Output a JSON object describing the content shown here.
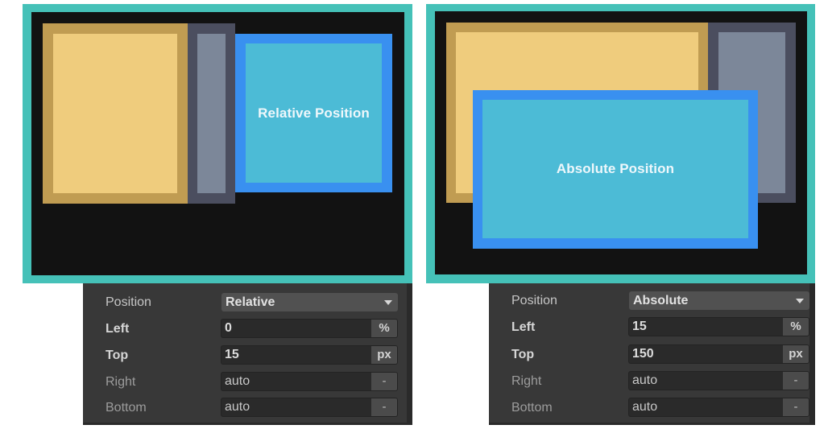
{
  "panels": [
    {
      "id": "relative",
      "box_label": "Relative Position",
      "inspector": {
        "position": {
          "label": "Position",
          "value": "Relative"
        },
        "left": {
          "label": "Left",
          "value": "0",
          "unit": "%"
        },
        "top": {
          "label": "Top",
          "value": "15",
          "unit": "px"
        },
        "right": {
          "label": "Right",
          "value": "auto",
          "unit": "-"
        },
        "bottom": {
          "label": "Bottom",
          "value": "auto",
          "unit": "-"
        }
      }
    },
    {
      "id": "absolute",
      "box_label": "Absolute Position",
      "inspector": {
        "position": {
          "label": "Position",
          "value": "Absolute"
        },
        "left": {
          "label": "Left",
          "value": "15",
          "unit": "%"
        },
        "top": {
          "label": "Top",
          "value": "150",
          "unit": "px"
        },
        "right": {
          "label": "Right",
          "value": "auto",
          "unit": "-"
        },
        "bottom": {
          "label": "Bottom",
          "value": "auto",
          "unit": "-"
        }
      }
    }
  ],
  "colors": {
    "frame": "#45c1b8",
    "canvas": "#121212",
    "yellow_border": "#c09c52",
    "yellow_fill": "#efcc7d",
    "gray_border": "#4b4e5f",
    "gray_fill": "#7c8799",
    "blue_border": "#3990f0",
    "blue_fill": "#4cbbd6",
    "inspector_bg": "#383838"
  }
}
